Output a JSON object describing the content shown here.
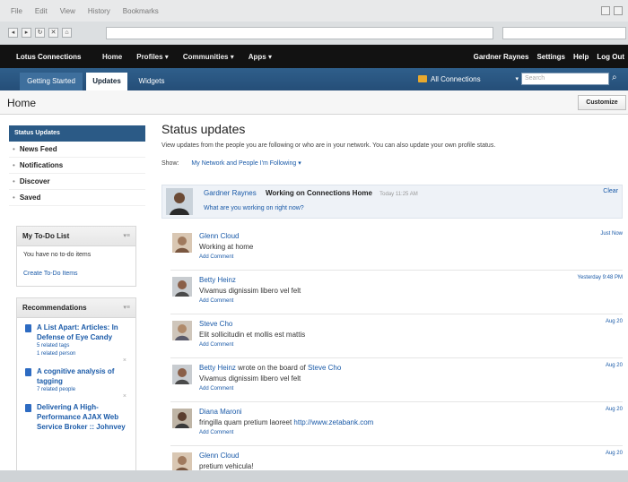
{
  "browser": {
    "menu": [
      "File",
      "Edit",
      "View",
      "History",
      "Bookmarks"
    ]
  },
  "topnav": {
    "brand": "Lotus Connections",
    "items": [
      "Home",
      "Profiles ▾",
      "Communities ▾",
      "Apps ▾"
    ],
    "user": "Gardner Raynes",
    "links": [
      "Settings",
      "Help",
      "Log Out"
    ]
  },
  "tabs": [
    "Getting Started",
    "Updates",
    "Widgets"
  ],
  "scope": {
    "label": "All Connections",
    "arrow": "▾"
  },
  "search": {
    "placeholder": "Search"
  },
  "home": {
    "title": "Home",
    "customize": "Customize"
  },
  "sidebar": {
    "selected": "Status Updates",
    "items": [
      "News Feed",
      "Notifications",
      "Discover",
      "Saved"
    ]
  },
  "todo": {
    "title": "My To-Do List",
    "message": "You have no to-do items",
    "link": "Create To-Do Items"
  },
  "recommendations": {
    "title": "Recommendations",
    "items": [
      {
        "title": "A List Apart: Articles: In Defense of Eye Candy",
        "sub1": "5 related tags",
        "sub2": "1 related person"
      },
      {
        "title": "A cognitive analysis of tagging",
        "sub1": "7 related people",
        "sub2": ""
      },
      {
        "title": "Delivering A High-Performance AJAX Web Service Broker :: Johnvey",
        "sub1": "",
        "sub2": ""
      }
    ]
  },
  "main": {
    "title": "Status updates",
    "description": "View updates from the people you are following or who are in your network. You can also update your own profile status.",
    "show_label": "Show:",
    "show_value": "My Network and People I'm Following ▾"
  },
  "my_status": {
    "name": "Gardner Raynes",
    "status": "Working on Connections Home",
    "time": "Today 11:25 AM",
    "prompt": "What are you working on right now?",
    "clear": "Clear"
  },
  "entries": [
    {
      "name": "Glenn Cloud",
      "mid": "",
      "target": "",
      "text": "Working at home",
      "link": "",
      "time": "Just Now",
      "add": "Add Comment"
    },
    {
      "name": "Betty Heinz",
      "mid": "",
      "target": "",
      "text": "Vivamus dignissim libero vel felt",
      "link": "",
      "time": "Yesterday 9:48 PM",
      "add": "Add Comment"
    },
    {
      "name": "Steve Cho",
      "mid": "",
      "target": "",
      "text": "Elit sollicitudin et mollis est mattis",
      "link": "",
      "time": "Aug 20",
      "add": "Add Comment"
    },
    {
      "name": "Betty Heinz",
      "mid": " wrote on the board of ",
      "target": "Steve Cho",
      "text": "Vivamus dignissim libero vel felt",
      "link": "",
      "time": "Aug 20",
      "add": "Add Comment"
    },
    {
      "name": "Diana Maroni",
      "mid": "",
      "target": "",
      "text": "fringilla quam pretium laoreet ",
      "link": "http://www.zetabank.com",
      "time": "Aug 20",
      "add": "Add Comment"
    },
    {
      "name": "Glenn Cloud",
      "mid": "",
      "target": "",
      "text": "pretium vehicula!",
      "link": "",
      "time": "Aug 20",
      "add": ""
    }
  ]
}
